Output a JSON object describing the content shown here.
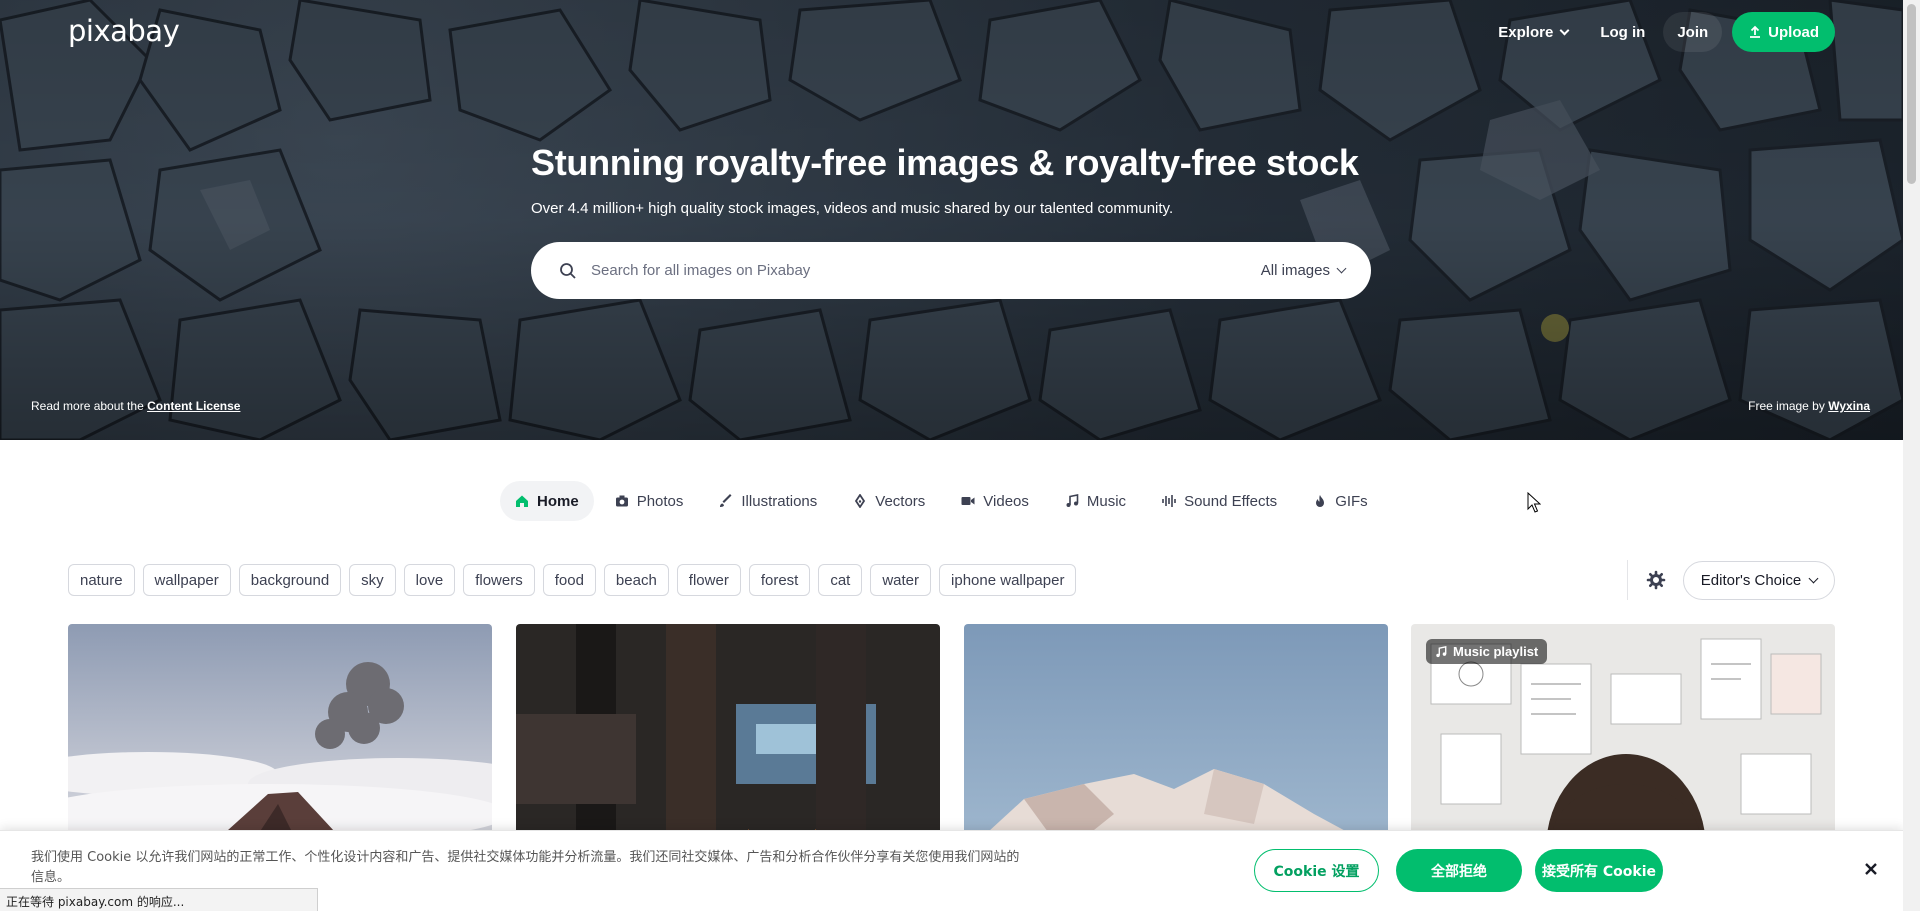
{
  "nav": {
    "logo": "pixabay",
    "explore": "Explore",
    "login": "Log in",
    "join": "Join",
    "upload": "Upload"
  },
  "hero": {
    "title": "Stunning royalty-free images & royalty-free stock",
    "subtitle": "Over 4.4 million+ high quality stock images, videos and music shared by our talented community.",
    "search_placeholder": "Search for all images on Pixabay",
    "filter": "All images",
    "license_prefix": "Read more about the ",
    "license_link": "Content License",
    "credit_prefix": "Free image by ",
    "credit_author": "Wyxina"
  },
  "tabs": [
    {
      "label": "Home",
      "icon": "home-icon"
    },
    {
      "label": "Photos",
      "icon": "camera-icon"
    },
    {
      "label": "Illustrations",
      "icon": "brush-icon"
    },
    {
      "label": "Vectors",
      "icon": "pen-nib-icon"
    },
    {
      "label": "Videos",
      "icon": "video-camera-icon"
    },
    {
      "label": "Music",
      "icon": "music-note-icon"
    },
    {
      "label": "Sound Effects",
      "icon": "waveform-icon"
    },
    {
      "label": "GIFs",
      "icon": "flame-icon"
    }
  ],
  "tags": [
    "nature",
    "wallpaper",
    "background",
    "sky",
    "love",
    "flowers",
    "food",
    "beach",
    "flower",
    "forest",
    "cat",
    "water",
    "iphone wallpaper"
  ],
  "sort": {
    "label": "Editor's Choice"
  },
  "grid": {
    "badge": "Music playlist"
  },
  "cookie": {
    "text": "我们使用 Cookie 以允许我们网站的正常工作、个性化设计内容和广告、提供社交媒体功能并分析流量。我们还同社交媒体、广告和分析合作伙伴分享有关您使用我们网站的信息。",
    "settings": "Cookie 设置",
    "reject_all": "全部拒绝",
    "accept_all": "接受所有 Cookie"
  },
  "status_bar": "正在等待 pixabay.com 的响应...",
  "colors": {
    "accent": "#02be6e"
  }
}
